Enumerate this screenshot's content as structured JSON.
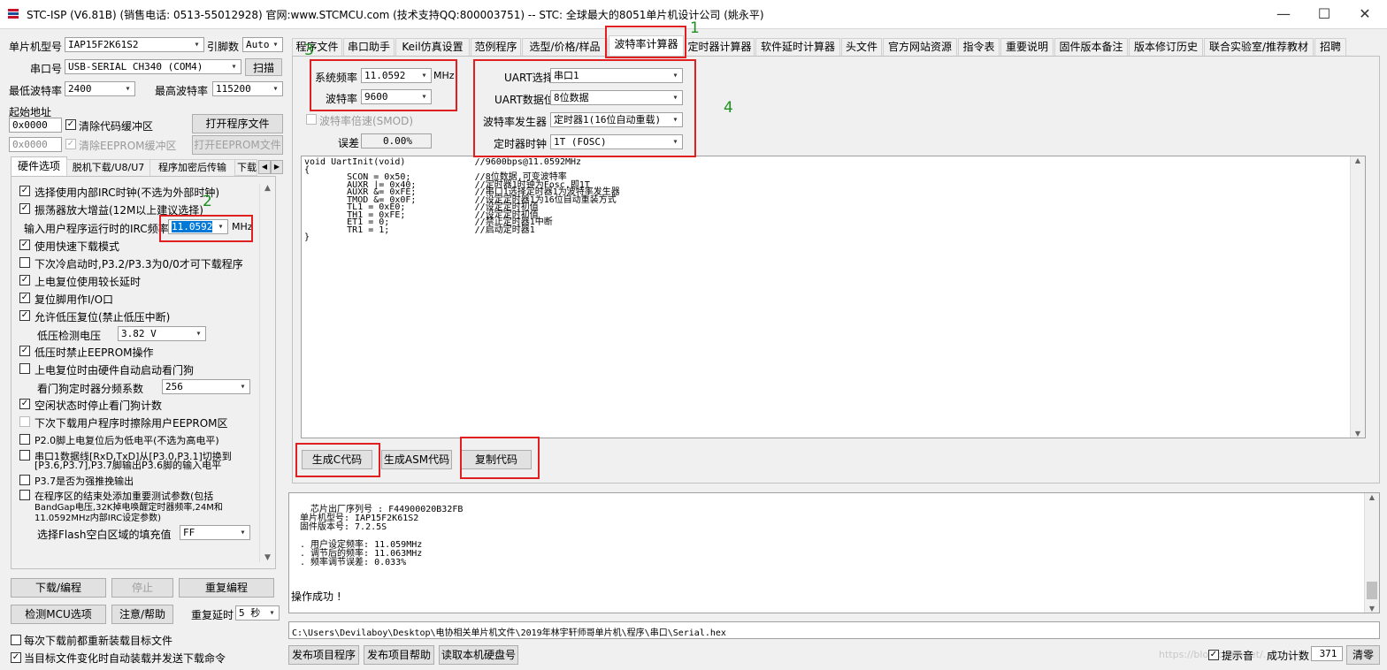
{
  "window": {
    "title": "STC-ISP (V6.81B) (销售电话: 0513-55012928) 官网:www.STCMCU.com  (技术支持QQ:800003751)  -- STC: 全球最大的8051单片机设计公司 (姚永平)",
    "minimize": "—",
    "maximize": "☐",
    "close": "✕"
  },
  "left": {
    "mcu_type_label": "单片机型号",
    "mcu_type_value": "IAP15F2K61S2",
    "pin_label": "引脚数",
    "pin_value": "Auto",
    "port_label": "串口号",
    "port_value": "USB-SERIAL CH340 (COM4)",
    "scan_button": "扫描",
    "min_baud_label": "最低波特率",
    "min_baud_value": "2400",
    "max_baud_label": "最高波特率",
    "max_baud_value": "115200",
    "start_addr_label": "起始地址",
    "addr1_value": "0x0000",
    "clear_code_label": "清除代码缓冲区",
    "open_prog_button": "打开程序文件",
    "addr2_value": "0x0000",
    "clear_eeprom_label": "清除EEPROM缓冲区",
    "open_eeprom_button": "打开EEPROM文件",
    "sub_tabs": [
      "硬件选项",
      "脱机下载/U8/U7",
      "程序加密后传输",
      "下载"
    ],
    "irc_freq_label": "输入用户程序运行时的IRC频率",
    "irc_freq_value": "11.0592",
    "irc_unit": "MHz",
    "options": [
      {
        "label": "选择使用内部IRC时钟(不选为外部时钟)",
        "checked": true
      },
      {
        "label": "振荡器放大增益(12M以上建议选择)",
        "checked": true
      },
      {
        "label": "使用快速下载模式",
        "checked": true
      },
      {
        "label": "下次冷启动时,P3.2/P3.3为0/0才可下载程序",
        "checked": false
      },
      {
        "label": "上电复位使用较长延时",
        "checked": true
      },
      {
        "label": "复位脚用作I/O口",
        "checked": true
      },
      {
        "label": "允许低压复位(禁止低压中断)",
        "checked": true
      },
      {
        "label": "低压时禁止EEPROM操作",
        "checked": true
      },
      {
        "label": "上电复位时由硬件自动启动看门狗",
        "checked": false
      },
      {
        "label": "空闲状态时停止看门狗计数",
        "checked": true
      },
      {
        "label": "下次下载用户程序时擦除用户EEPROM区",
        "checked": false
      },
      {
        "label": "P2.0脚上电复位后为低电平(不选为高电平)",
        "checked": false
      },
      {
        "label": "串口1数据线[RxD,TxD]从[P3.0,P3.1]切换到",
        "checked": false
      },
      {
        "label": "[P3.6,P3.7],P3.7脚输出P3.6脚的输入电平",
        "checked": false
      },
      {
        "label": "P3.7是否为强推挽输出",
        "checked": false
      },
      {
        "label": "在程序区的结束处添加重要测试参数(包括",
        "checked": false
      },
      {
        "label": "BandGap电压,32K掉电唤醒定时器频率,24M和",
        "checked": false
      },
      {
        "label": "11.0592MHz内部IRC设定参数)",
        "checked": false
      }
    ],
    "low_volt_label": "低压检测电压",
    "low_volt_value": "3.82 V",
    "wdt_label": "看门狗定时器分频系数",
    "wdt_value": "256",
    "flash_fill_label": "选择Flash空白区域的填充值",
    "flash_fill_value": "FF",
    "download_button": "下载/编程",
    "stop_button": "停止",
    "reprogram_button": "重复编程",
    "check_mcu_button": "检测MCU选项",
    "help_button": "注意/帮助",
    "repeat_delay_label": "重复延时",
    "repeat_delay_value": "5 秒",
    "reload_label": "每次下载前都重新装载目标文件",
    "auto_send_label": "当目标文件变化时自动装载并发送下载命令"
  },
  "tabs": [
    "程序文件",
    "串口助手",
    "Keil仿真设置",
    "范例程序",
    "选型/价格/样品",
    "波特率计算器",
    "定时器计算器",
    "软件延时计算器",
    "头文件",
    "官方网站资源",
    "指令表",
    "重要说明",
    "固件版本备注",
    "版本修订历史",
    "联合实验室/推荐教材",
    "招聘"
  ],
  "calc": {
    "sysfreq_label": "系统频率",
    "sysfreq_value": "11.0592",
    "sysfreq_unit": "MHz",
    "baud_label": "波特率",
    "baud_value": "9600",
    "double_label": "波特率倍速(SMOD)",
    "error_label": "误差",
    "error_value": "0.00%",
    "uart_label": "UART选择",
    "uart_value": "串口1",
    "databits_label": "UART数据位",
    "databits_value": "8位数据",
    "gen_label": "波特率发生器",
    "gen_value": "定时器1(16位自动重载)",
    "clock_label": "定时器时钟",
    "clock_value": "1T  (FOSC)",
    "code": "void UartInit(void)             //9600bps@11.0592MHz\n{\n        SCON = 0x50;            //8位数据,可变波特率\n        AUXR |= 0x40;           //定时器1时钟为Fosc,即1T\n        AUXR &= 0xFE;           //串口1选择定时器1为波特率发生器\n        TMOD &= 0x0F;           //设定定时器1为16位自动重装方式\n        TL1 = 0xE0;             //设定定时初值\n        TH1 = 0xFE;             //设定定时初值\n        ET1 = 0;                //禁止定时器1中断\n        TR1 = 1;                //启动定时器1\n}",
    "gen_c_button": "生成C代码",
    "gen_asm_button": "生成ASM代码",
    "copy_button": "复制代码"
  },
  "annotations": [
    "1",
    "2",
    "3",
    "4"
  ],
  "info": {
    "text": "  芯片出厂序列号 : F44900020B32FB\n单片机型号: IAP15F2K61S2\n固件版本号: 7.2.5S\n\n. 用户设定频率: 11.059MHz\n. 调节后的频率: 11.063MHz\n. 频率调节误差: 0.033%",
    "status": "操作成功 !"
  },
  "path": "C:\\Users\\Devilaboy\\Desktop\\电协相关单片机文件\\2019年林宇轩师哥单片机\\程序\\串口\\Serial.hex",
  "bottom": {
    "publish_prog_button": "发布项目程序",
    "publish_help_button": "发布项目帮助",
    "read_disk_button": "读取本机硬盘号",
    "hint_label": "提示音",
    "success_count_label": "成功计数",
    "success_count_value": "371",
    "clear_button": "清零",
    "watermark": "https://blog.csdn.net/..."
  }
}
